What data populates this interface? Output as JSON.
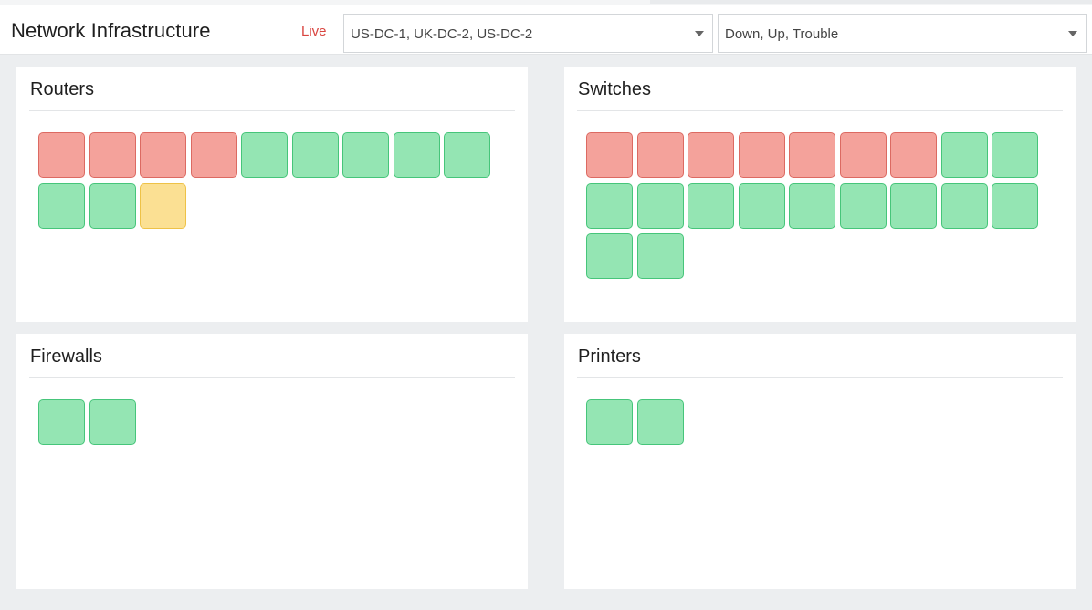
{
  "header": {
    "title": "Network Infrastructure",
    "live_label": "Live",
    "datacenter_filter": "US-DC-1, UK-DC-2, US-DC-2",
    "status_filter": "Down, Up, Trouble"
  },
  "colors": {
    "down": "#f4a29b",
    "up": "#94e5b3",
    "trouble": "#fbe093",
    "live": "#d9443f"
  },
  "panels": [
    {
      "id": "routers",
      "title": "Routers",
      "devices": [
        "down",
        "down",
        "down",
        "down",
        "up",
        "up",
        "up",
        "up",
        "up",
        "up",
        "up",
        "trouble"
      ]
    },
    {
      "id": "switches",
      "title": "Switches",
      "devices": [
        "down",
        "down",
        "down",
        "down",
        "down",
        "down",
        "down",
        "up",
        "up",
        "up",
        "up",
        "up",
        "up",
        "up",
        "up",
        "up",
        "up",
        "up",
        "up",
        "up"
      ]
    },
    {
      "id": "firewalls",
      "title": "Firewalls",
      "devices": [
        "up",
        "up"
      ]
    },
    {
      "id": "printers",
      "title": "Printers",
      "devices": [
        "up",
        "up"
      ]
    }
  ]
}
